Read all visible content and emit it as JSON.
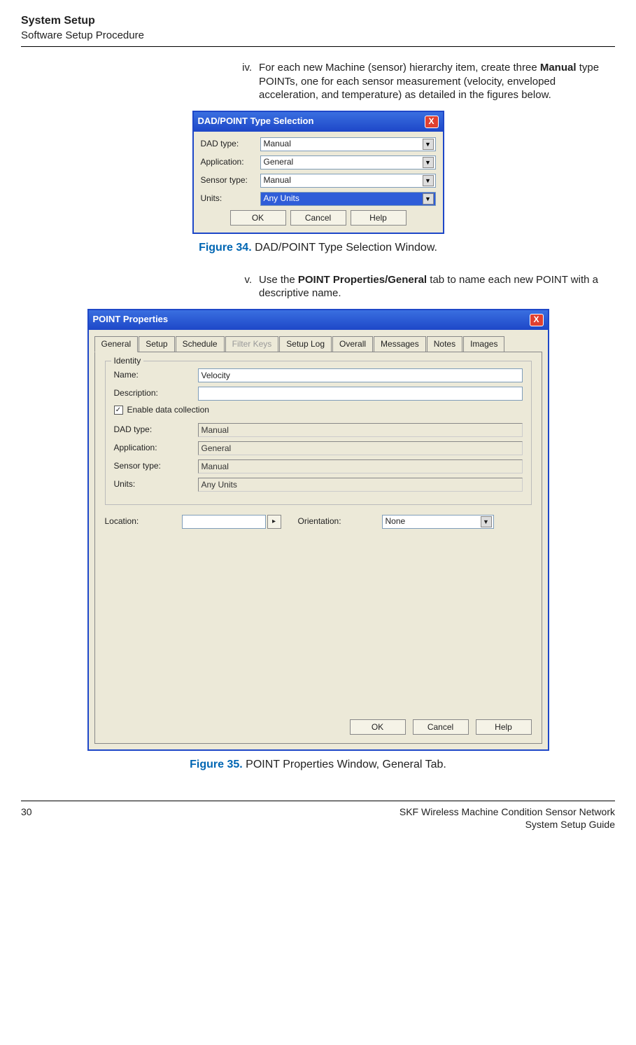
{
  "header": {
    "title": "System Setup",
    "subtitle": "Software Setup Procedure"
  },
  "step_iv": {
    "num": "iv.",
    "pre": "For each new Machine (sensor) hierarchy item, create three ",
    "bold": "Manual",
    "post": " type POINTs, one for each sensor measurement (velocity, enveloped acceleration, and temperature) as detailed in the figures below."
  },
  "dialog1": {
    "title": "DAD/POINT Type Selection",
    "close": "X",
    "rows": {
      "dad_label": "DAD type:",
      "dad_value": "Manual",
      "app_label": "Application:",
      "app_value": "General",
      "sensor_label": "Sensor type:",
      "sensor_value": "Manual",
      "units_label": "Units:",
      "units_value": "Any Units"
    },
    "buttons": {
      "ok": "OK",
      "cancel": "Cancel",
      "help": "Help"
    }
  },
  "figure34": {
    "label": "Figure 34.",
    "caption": " DAD/POINT Type Selection Window."
  },
  "step_v": {
    "num": "v.",
    "pre": "Use the ",
    "bold": "POINT Properties/General",
    "post": " tab to name each new POINT with a descriptive name."
  },
  "dialog2": {
    "title": "POINT Properties",
    "close": "X",
    "tabs": {
      "general": "General",
      "setup": "Setup",
      "schedule": "Schedule",
      "filterkeys": "Filter Keys",
      "setuplog": "Setup Log",
      "overall": "Overall",
      "messages": "Messages",
      "notes": "Notes",
      "images": "Images"
    },
    "identity_legend": "Identity",
    "name_label": "Name:",
    "name_value": "Velocity",
    "desc_label": "Description:",
    "desc_value": "",
    "enable_label": "Enable data collection",
    "enable_checked": "✓",
    "dad_label": "DAD type:",
    "dad_value": "Manual",
    "app_label": "Application:",
    "app_value": "General",
    "sensor_label": "Sensor type:",
    "sensor_value": "Manual",
    "units_label": "Units:",
    "units_value": "Any Units",
    "location_label": "Location:",
    "location_btn": "▸",
    "orientation_label": "Orientation:",
    "orientation_value": "None",
    "buttons": {
      "ok": "OK",
      "cancel": "Cancel",
      "help": "Help"
    }
  },
  "figure35": {
    "label": "Figure 35.",
    "caption": " POINT Properties Window, General Tab."
  },
  "footer": {
    "page": "30",
    "line1": "SKF Wireless Machine Condition Sensor Network",
    "line2": "System Setup Guide"
  }
}
